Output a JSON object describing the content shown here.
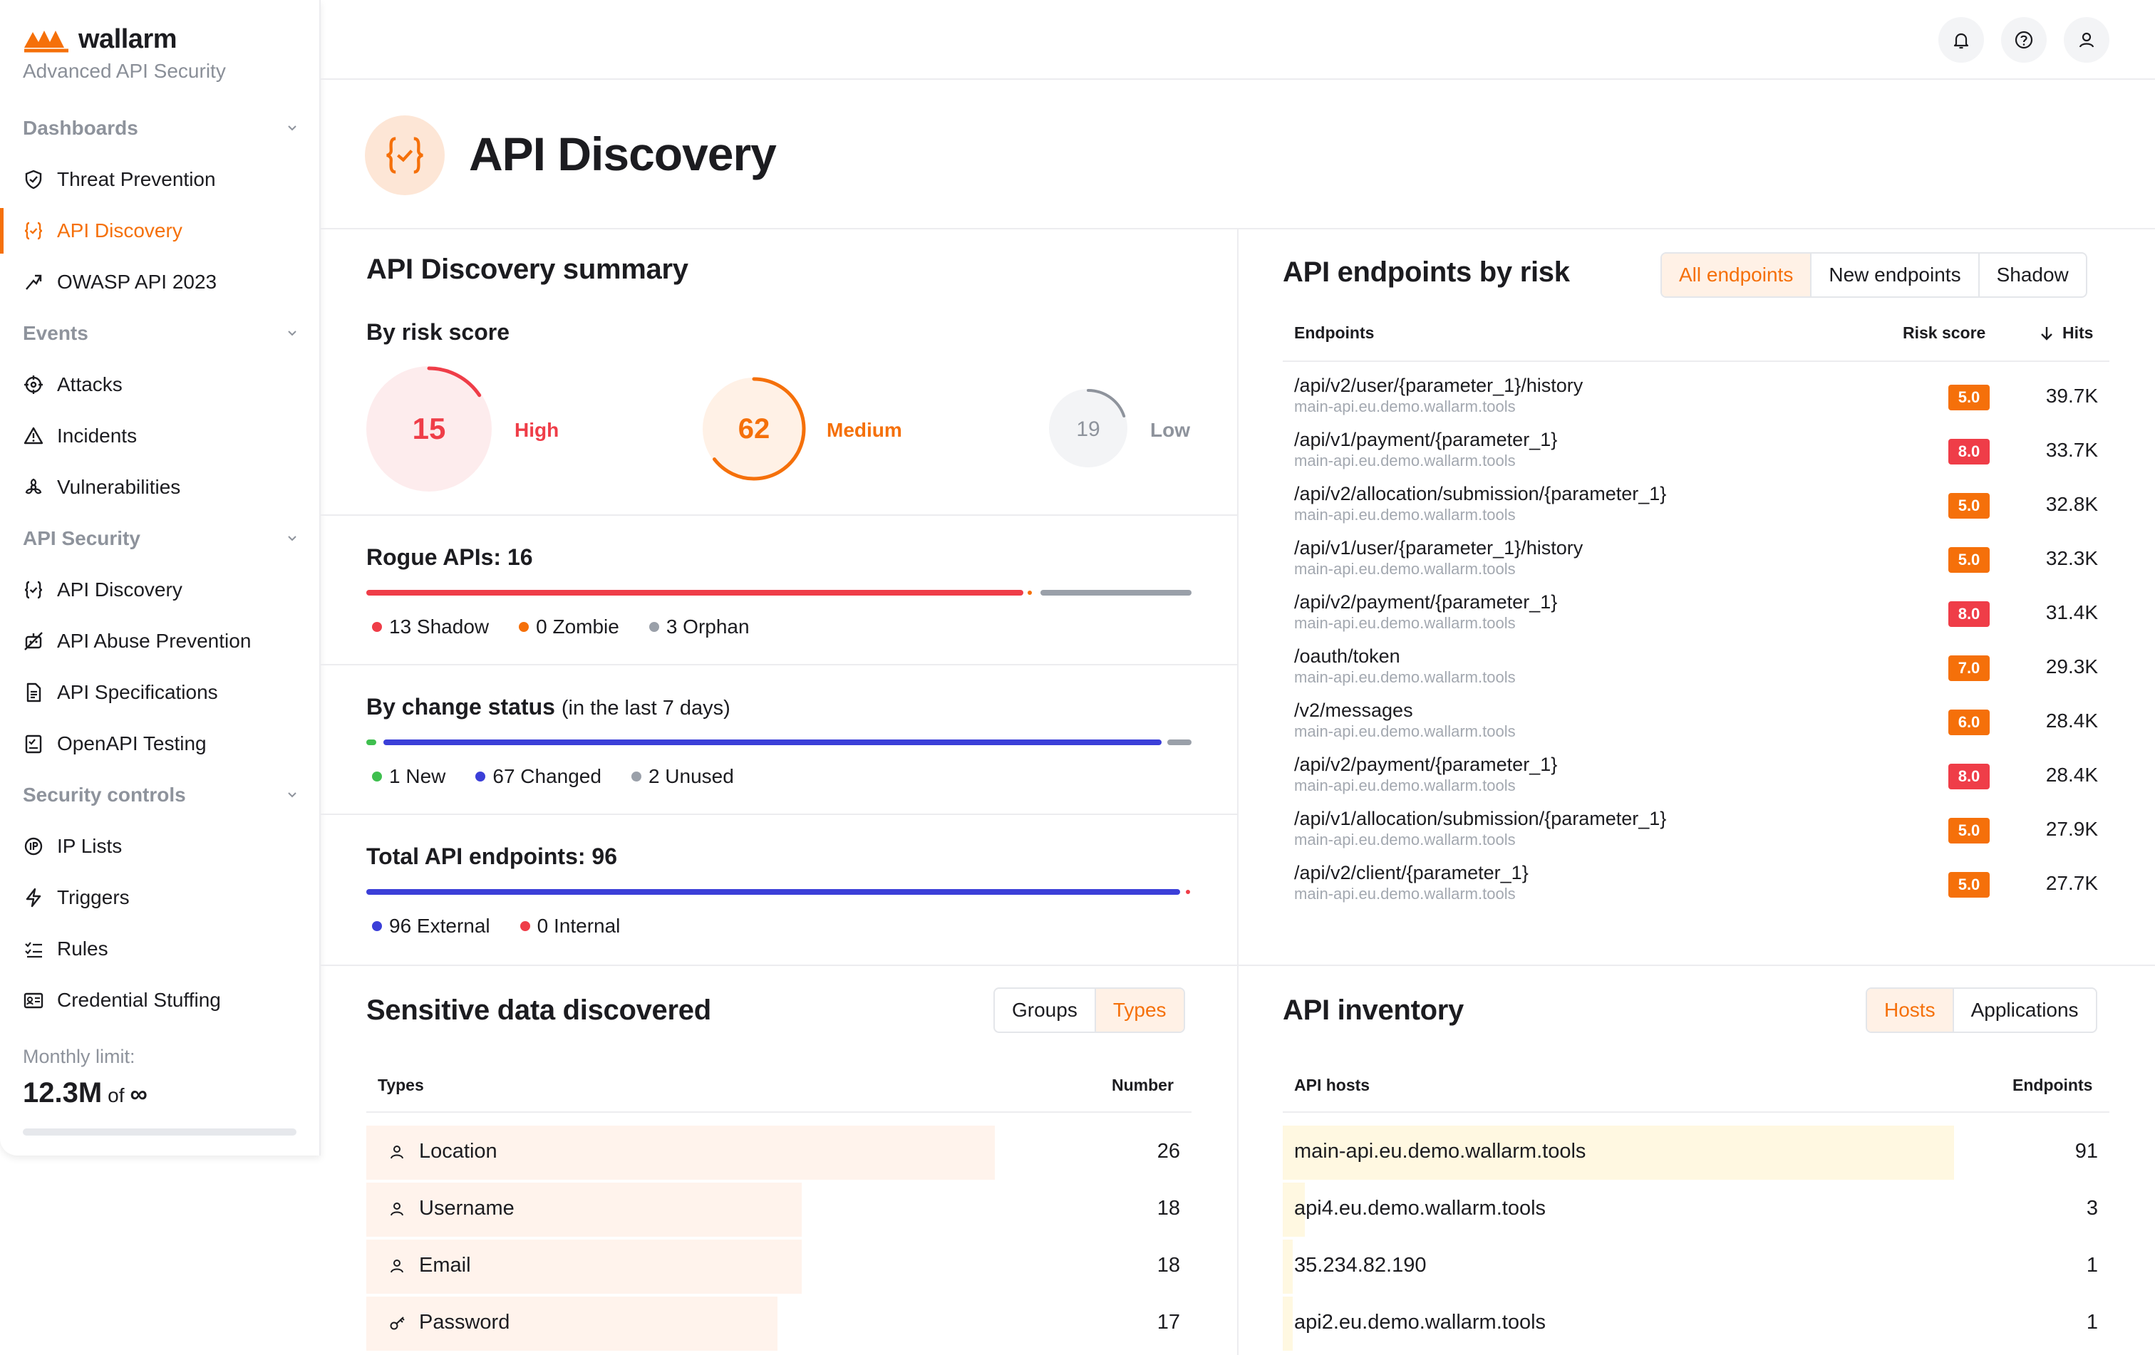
{
  "brand": {
    "name": "wallarm",
    "subtitle": "Advanced API Security"
  },
  "sidebar": {
    "sections": [
      {
        "label": "Dashboards",
        "items": [
          {
            "label": "Threat Prevention",
            "icon": "shield-icon"
          },
          {
            "label": "API Discovery",
            "icon": "braces-check-icon",
            "active": true
          },
          {
            "label": "OWASP API 2023",
            "icon": "arrow-icon"
          }
        ]
      },
      {
        "label": "Events",
        "items": [
          {
            "label": "Attacks",
            "icon": "crosshair-icon"
          },
          {
            "label": "Incidents",
            "icon": "warning-icon"
          },
          {
            "label": "Vulnerabilities",
            "icon": "biohazard-icon"
          }
        ]
      },
      {
        "label": "API Security",
        "items": [
          {
            "label": "API Discovery",
            "icon": "braces-check-icon"
          },
          {
            "label": "API Abuse Prevention",
            "icon": "robot-icon"
          },
          {
            "label": "API Specifications",
            "icon": "document-icon"
          },
          {
            "label": "OpenAPI Testing",
            "icon": "checklist-icon"
          }
        ]
      },
      {
        "label": "Security controls",
        "items": [
          {
            "label": "IP Lists",
            "icon": "ip-icon"
          },
          {
            "label": "Triggers",
            "icon": "bolt-icon"
          },
          {
            "label": "Rules",
            "icon": "rules-icon"
          },
          {
            "label": "Credential Stuffing",
            "icon": "credential-icon"
          }
        ]
      }
    ],
    "limit": {
      "label": "Monthly limit:",
      "value": "12.3M",
      "of": "of",
      "max": "∞"
    }
  },
  "page": {
    "title": "API Discovery"
  },
  "summary": {
    "title": "API Discovery summary",
    "risk_title": "By risk score",
    "risk": {
      "high": {
        "value": "15",
        "label": "High",
        "color": "#ef3d48"
      },
      "medium": {
        "value": "62",
        "label": "Medium",
        "color": "#f5700a"
      },
      "low": {
        "value": "19",
        "label": "Low",
        "color": "#8e939c"
      }
    },
    "rogue": {
      "title": "Rogue APIs: 16",
      "legend": [
        {
          "label": "13 Shadow",
          "color": "#ef3d48",
          "count": 13
        },
        {
          "label": "0 Zombie",
          "color": "#f5700a",
          "count": 0
        },
        {
          "label": "3 Orphan",
          "color": "#9aa0a9",
          "count": 3
        }
      ]
    },
    "change": {
      "title": "By change status",
      "subtitle": "(in the last 7 days)",
      "legend": [
        {
          "label": "1 New",
          "color": "#3fbf4f",
          "count": 1
        },
        {
          "label": "67 Changed",
          "color": "#3b3fd8",
          "count": 67
        },
        {
          "label": "2 Unused",
          "color": "#9aa0a9",
          "count": 2
        }
      ]
    },
    "total": {
      "title": "Total API endpoints: 96",
      "legend": [
        {
          "label": "96 External",
          "color": "#3b3fd8",
          "count": 96
        },
        {
          "label": "0 Internal",
          "color": "#ef3d48",
          "count": 0
        }
      ]
    }
  },
  "endpoints": {
    "title": "API endpoints by risk",
    "tabs": [
      "All endpoints",
      "New endpoints",
      "Shadow"
    ],
    "headers": {
      "endpoints": "Endpoints",
      "risk": "Risk score",
      "hits": "Hits"
    },
    "rows": [
      {
        "path": "/api/v2/user/{parameter_1}/history",
        "host": "main-api.eu.demo.wallarm.tools",
        "risk": "5.0",
        "hits": "39.7K"
      },
      {
        "path": "/api/v1/payment/{parameter_1}",
        "host": "main-api.eu.demo.wallarm.tools",
        "risk": "8.0",
        "hits": "33.7K"
      },
      {
        "path": "/api/v2/allocation/submission/{parameter_1}",
        "host": "main-api.eu.demo.wallarm.tools",
        "risk": "5.0",
        "hits": "32.8K"
      },
      {
        "path": "/api/v1/user/{parameter_1}/history",
        "host": "main-api.eu.demo.wallarm.tools",
        "risk": "5.0",
        "hits": "32.3K"
      },
      {
        "path": "/api/v2/payment/{parameter_1}",
        "host": "main-api.eu.demo.wallarm.tools",
        "risk": "8.0",
        "hits": "31.4K"
      },
      {
        "path": "/oauth/token",
        "host": "main-api.eu.demo.wallarm.tools",
        "risk": "7.0",
        "hits": "29.3K"
      },
      {
        "path": "/v2/messages",
        "host": "main-api.eu.demo.wallarm.tools",
        "risk": "6.0",
        "hits": "28.4K"
      },
      {
        "path": "/api/v2/payment/{parameter_1}",
        "host": "main-api.eu.demo.wallarm.tools",
        "risk": "8.0",
        "hits": "28.4K"
      },
      {
        "path": "/api/v1/allocation/submission/{parameter_1}",
        "host": "main-api.eu.demo.wallarm.tools",
        "risk": "5.0",
        "hits": "27.9K"
      },
      {
        "path": "/api/v2/client/{parameter_1}",
        "host": "main-api.eu.demo.wallarm.tools",
        "risk": "5.0",
        "hits": "27.7K"
      }
    ],
    "risk_colors": {
      "5.0": "#f5700a",
      "6.0": "#f5700a",
      "7.0": "#f5700a",
      "8.0": "#ef3d48"
    }
  },
  "sensitive": {
    "title": "Sensitive data discovered",
    "tabs": [
      "Groups",
      "Types"
    ],
    "headers": {
      "types": "Types",
      "number": "Number"
    },
    "rows": [
      {
        "label": "Location",
        "icon": "person-icon",
        "number": "26",
        "value": 26
      },
      {
        "label": "Username",
        "icon": "person-icon",
        "number": "18",
        "value": 18
      },
      {
        "label": "Email",
        "icon": "person-icon",
        "number": "18",
        "value": 18
      },
      {
        "label": "Password",
        "icon": "key-icon",
        "number": "17",
        "value": 17
      }
    ]
  },
  "inventory": {
    "title": "API inventory",
    "tabs": [
      "Hosts",
      "Applications"
    ],
    "headers": {
      "hosts": "API hosts",
      "endpoints": "Endpoints"
    },
    "rows": [
      {
        "host": "main-api.eu.demo.wallarm.tools",
        "number": "91",
        "value": 91
      },
      {
        "host": "api4.eu.demo.wallarm.tools",
        "number": "3",
        "value": 3
      },
      {
        "host": "35.234.82.190",
        "number": "1",
        "value": 1
      },
      {
        "host": "api2.eu.demo.wallarm.tools",
        "number": "1",
        "value": 1
      }
    ]
  }
}
